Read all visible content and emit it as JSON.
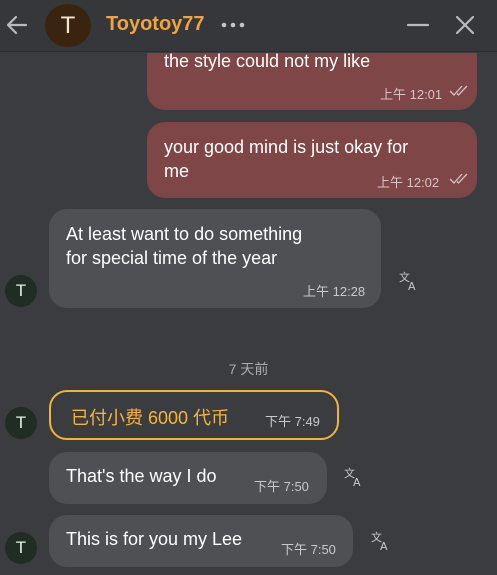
{
  "header": {
    "avatar_letter": "T",
    "contact_name": "Toyotoy77"
  },
  "messages": {
    "out1": {
      "text": "the style could not my like",
      "time": "上午 12:01"
    },
    "out2": {
      "line1": "your good mind is just okay for",
      "line2": "me",
      "time": "上午 12:02"
    },
    "in1": {
      "line1": "At least want to do something",
      "line2": "for special time of the year",
      "time": "上午 12:28"
    },
    "date_separator": "7 天前",
    "tip": {
      "text": "已付小费 6000 代币",
      "time": "下午 7:49"
    },
    "in2": {
      "text": "That's the way I do",
      "time": "下午 7:50"
    },
    "in3": {
      "text": "This is for you my Lee",
      "time": "下午 7:50"
    }
  },
  "avatar_letter": "T",
  "colors": {
    "background": "#3b3c3f",
    "outgoing_bubble": "#7e4647",
    "incoming_bubble": "#4f5053",
    "accent": "#f0a43a",
    "tip_border": "#f0b43a"
  }
}
